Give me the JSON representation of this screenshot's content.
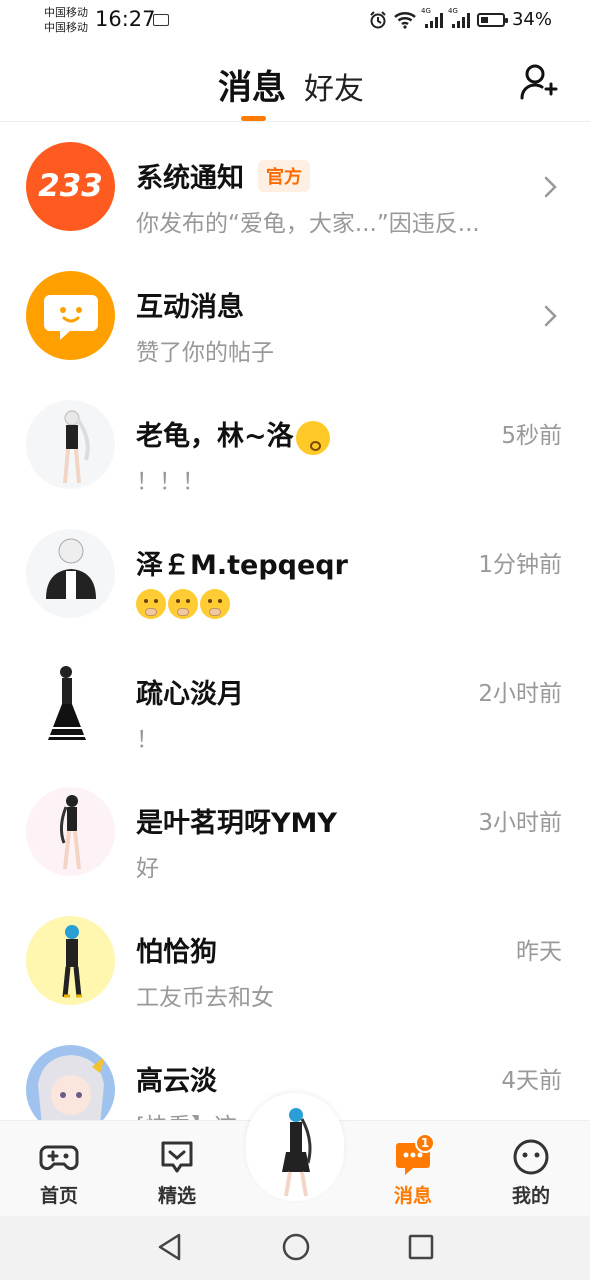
{
  "status_bar": {
    "carrier_1": "中国移动",
    "carrier_2": "中国移动",
    "time": "16:27",
    "network_1": "4G",
    "network_2": "4G",
    "battery": "34%",
    "icons": [
      "app-notification-icon",
      "alarm-icon",
      "wifi-icon",
      "signal-icon",
      "signal-icon",
      "battery-icon"
    ]
  },
  "header": {
    "tab_active": "消息",
    "tab_inactive": "好友",
    "accent_color": "#ff7a00",
    "right_icon": "add-friend-icon"
  },
  "messages": [
    {
      "title": "系统通知",
      "badge": "官方",
      "subtitle": "你发布的“爱龟，大家...”因违反...",
      "time": "",
      "avatar_text": "233",
      "avatar_color": "#ff5a1f",
      "chevron": true
    },
    {
      "title": "互动消息",
      "subtitle": "赞了你的帖子",
      "time": "",
      "avatar_icon": "chat-bubble-icon",
      "avatar_color": "#ffa000",
      "chevron": true
    },
    {
      "title": "老龟，林~洛",
      "title_emoji": "kissing-face-emoji",
      "subtitle": "！！！",
      "time": "5秒前"
    },
    {
      "title": "泽￡M.tepqeqr",
      "subtitle_emoji": [
        "face-with-hand-over-mouth-emoji",
        "face-with-hand-over-mouth-emoji",
        "face-with-hand-over-mouth-emoji"
      ],
      "subtitle": "",
      "time": "1分钟前"
    },
    {
      "title": "疏心淡月",
      "subtitle": "！",
      "time": "2小时前"
    },
    {
      "title": "是叶茗玥呀YMY",
      "subtitle": "好",
      "time": "3小时前"
    },
    {
      "title": "怕恰狗",
      "subtitle": "工友币去和女",
      "time": "昨天",
      "avatar_color": "#fff6b0"
    },
    {
      "title": "高云淡",
      "subtitle": "[快看】这",
      "time": "4天前",
      "avatar_color": "#9fc3ee"
    }
  ],
  "bottom_nav": {
    "items": [
      {
        "label": "首页",
        "icon": "gamepad-icon",
        "active": false
      },
      {
        "label": "精选",
        "icon": "heart-chat-icon",
        "active": false
      },
      {
        "label": "消息",
        "icon": "message-icon",
        "active": true,
        "badge": "1"
      },
      {
        "label": "我的",
        "icon": "face-icon",
        "active": false
      }
    ],
    "center_icon": "character-avatar"
  },
  "system_nav": [
    "back-icon",
    "home-icon",
    "recents-icon"
  ]
}
